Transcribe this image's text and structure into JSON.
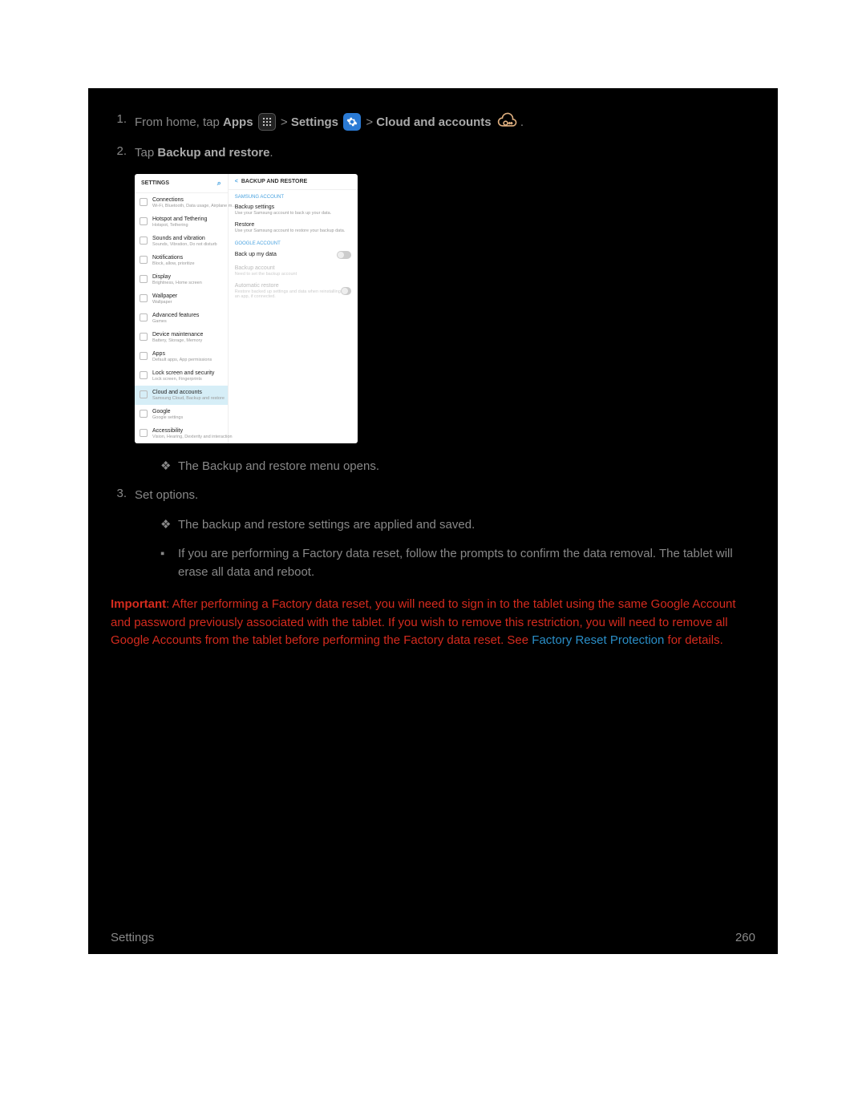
{
  "steps": {
    "s1": {
      "num": "1.",
      "pre": "From home, tap ",
      "apps": "Apps",
      "sep1": " > ",
      "settings": "Settings",
      "sep2": " > ",
      "cloud": "Cloud and accounts",
      "end": "."
    },
    "s2": {
      "num": "2.",
      "pre": "Tap ",
      "bold": "Backup and restore",
      "end": "."
    },
    "s2_result": "The Backup and restore menu opens.",
    "s3": {
      "num": "3.",
      "text": "Set options."
    },
    "s3_result": "The backup and restore settings are applied and saved.",
    "s3_note": "If you are performing a Factory data reset, follow the prompts to confirm the data removal. The tablet will erase all data and reboot."
  },
  "important": {
    "label": "Important",
    "body1": ": After performing a Factory data reset, you will need to sign in to the tablet using the same Google Account and password previously associated with the tablet. If you wish to remove this restriction, you will need to remove all Google Accounts from the tablet before performing the Factory data reset. See ",
    "link": "Factory Reset Protection",
    "body2": " for details."
  },
  "footer": {
    "left": "Settings",
    "right": "260"
  },
  "screenshot": {
    "left_header": "SETTINGS",
    "right_header": "BACKUP AND RESTORE",
    "left_items": [
      {
        "t": "Connections",
        "s": "Wi-Fi, Bluetooth, Data usage, Airplane m…"
      },
      {
        "t": "Hotspot and Tethering",
        "s": "Hotspot, Tethering"
      },
      {
        "t": "Sounds and vibration",
        "s": "Sounds, Vibration, Do not disturb"
      },
      {
        "t": "Notifications",
        "s": "Block, allow, prioritize"
      },
      {
        "t": "Display",
        "s": "Brightness, Home screen"
      },
      {
        "t": "Wallpaper",
        "s": "Wallpaper"
      },
      {
        "t": "Advanced features",
        "s": "Games"
      },
      {
        "t": "Device maintenance",
        "s": "Battery, Storage, Memory"
      },
      {
        "t": "Apps",
        "s": "Default apps, App permissions"
      },
      {
        "t": "Lock screen and security",
        "s": "Lock screen, Fingerprints"
      },
      {
        "t": "Cloud and accounts",
        "s": "Samsung Cloud, Backup and restore"
      },
      {
        "t": "Google",
        "s": "Google settings"
      },
      {
        "t": "Accessibility",
        "s": "Vision, Hearing, Dexterity and interaction"
      }
    ],
    "samsung_label": "SAMSUNG ACCOUNT",
    "google_label": "GOOGLE ACCOUNT",
    "r1": {
      "t": "Backup settings",
      "s": "Use your Samsung account to back up your data."
    },
    "r2": {
      "t": "Restore",
      "s": "Use your Samsung account to restore your backup data."
    },
    "r3": {
      "t": "Back up my data"
    },
    "r4": {
      "t": "Backup account",
      "s": "Need to set the backup account"
    },
    "r5": {
      "t": "Automatic restore",
      "s": "Restore backed up settings and data when reinstalling an app, if connected."
    }
  }
}
